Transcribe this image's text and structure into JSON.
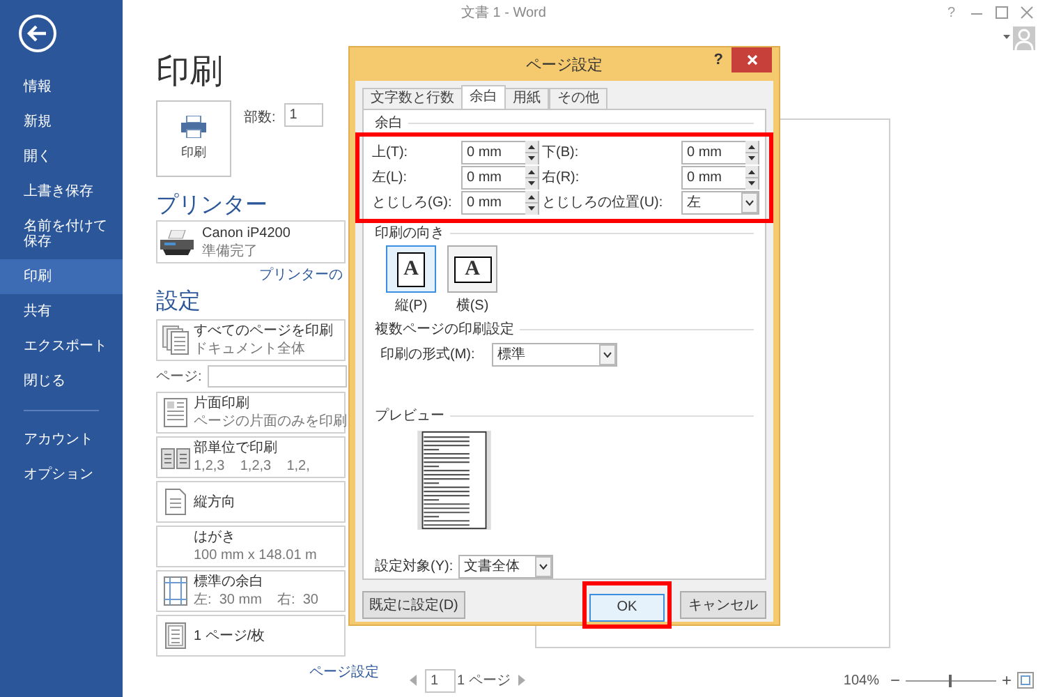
{
  "window": {
    "title": "文書 1 - Word",
    "help": "?"
  },
  "sidebar": {
    "items": [
      {
        "label": "情報",
        "selected": false
      },
      {
        "label": "新規",
        "selected": false
      },
      {
        "label": "開く",
        "selected": false
      },
      {
        "label": "上書き保存",
        "selected": false
      },
      {
        "label": "名前を付けて保存",
        "selected": false
      },
      {
        "label": "印刷",
        "selected": true
      },
      {
        "label": "共有",
        "selected": false
      },
      {
        "label": "エクスポート",
        "selected": false
      },
      {
        "label": "閉じる",
        "selected": false
      }
    ],
    "account_items": [
      {
        "label": "アカウント",
        "selected": false
      },
      {
        "label": "オプション",
        "selected": false
      }
    ]
  },
  "backstage": {
    "title": "印刷",
    "print_button": "印刷",
    "copies_label": "部数:",
    "copies_value": "1",
    "printer_heading": "プリンター",
    "printer": {
      "name": "Canon iP4200",
      "status": "準備完了"
    },
    "printer_properties_link": "プリンターの",
    "settings_heading": "設定",
    "settings": [
      {
        "kind": "pages",
        "title": "すべてのページを印刷",
        "subtitle": "ドキュメント全体"
      },
      {
        "kind": "page-range",
        "label": "ページ:"
      },
      {
        "kind": "sides",
        "title": "片面印刷",
        "subtitle": "ページの片面のみを印刷"
      },
      {
        "kind": "collate",
        "title": "部単位で印刷",
        "subtitle": "1,2,3    1,2,3    1,2,"
      },
      {
        "kind": "orientation",
        "title": "縦方向"
      },
      {
        "kind": "paper",
        "title": "はがき",
        "subtitle": "100 mm x 148.01 m"
      },
      {
        "kind": "margins",
        "title": "標準の余白",
        "subtitle": "左:  30 mm    右:  30"
      },
      {
        "kind": "per-sheet",
        "title": "1 ページ/枚"
      }
    ],
    "page_setup_link": "ページ設定"
  },
  "page_nav": {
    "current": "1",
    "total": "1 ページ"
  },
  "zoom": {
    "label": "104%",
    "minus": "−",
    "plus": "+",
    "level": 0.5
  },
  "dialog": {
    "title": "ページ設定",
    "help": "?",
    "tabs": [
      {
        "label": "文字数と行数",
        "selected": false
      },
      {
        "label": "余白",
        "selected": true
      },
      {
        "label": "用紙",
        "selected": false
      },
      {
        "label": "その他",
        "selected": false
      }
    ],
    "margins": {
      "group_label": "余白",
      "highlighted": true,
      "fields": [
        {
          "kind": "spin",
          "label": "上(T):",
          "value": "0 mm"
        },
        {
          "kind": "spin",
          "label": "下(B):",
          "value": "0 mm"
        },
        {
          "kind": "spin",
          "label": "左(L):",
          "value": "0 mm"
        },
        {
          "kind": "spin",
          "label": "右(R):",
          "value": "0 mm"
        },
        {
          "kind": "spin",
          "label": "とじしろ(G):",
          "value": "0 mm"
        },
        {
          "kind": "select",
          "label": "とじしろの位置(U):",
          "value": "左"
        }
      ]
    },
    "orientation": {
      "group_label": "印刷の向き",
      "options": [
        {
          "kind": "portrait",
          "glyph": "A",
          "label": "縦(P)",
          "selected": true
        },
        {
          "kind": "landscape",
          "glyph": "A",
          "label": "横(S)",
          "selected": false
        }
      ]
    },
    "multiple_pages": {
      "group_label": "複数ページの印刷設定",
      "format_label": "印刷の形式(M):",
      "format_value": "標準"
    },
    "preview": {
      "group_label": "プレビュー"
    },
    "apply_to": {
      "label": "設定対象(Y):",
      "value": "文書全体"
    },
    "buttons": [
      {
        "kind": "default",
        "label": "既定に設定(D)",
        "highlighted": false
      },
      {
        "kind": "ok",
        "label": "OK",
        "highlighted": true
      },
      {
        "kind": "cancel",
        "label": "キャンセル",
        "highlighted": false
      }
    ]
  }
}
